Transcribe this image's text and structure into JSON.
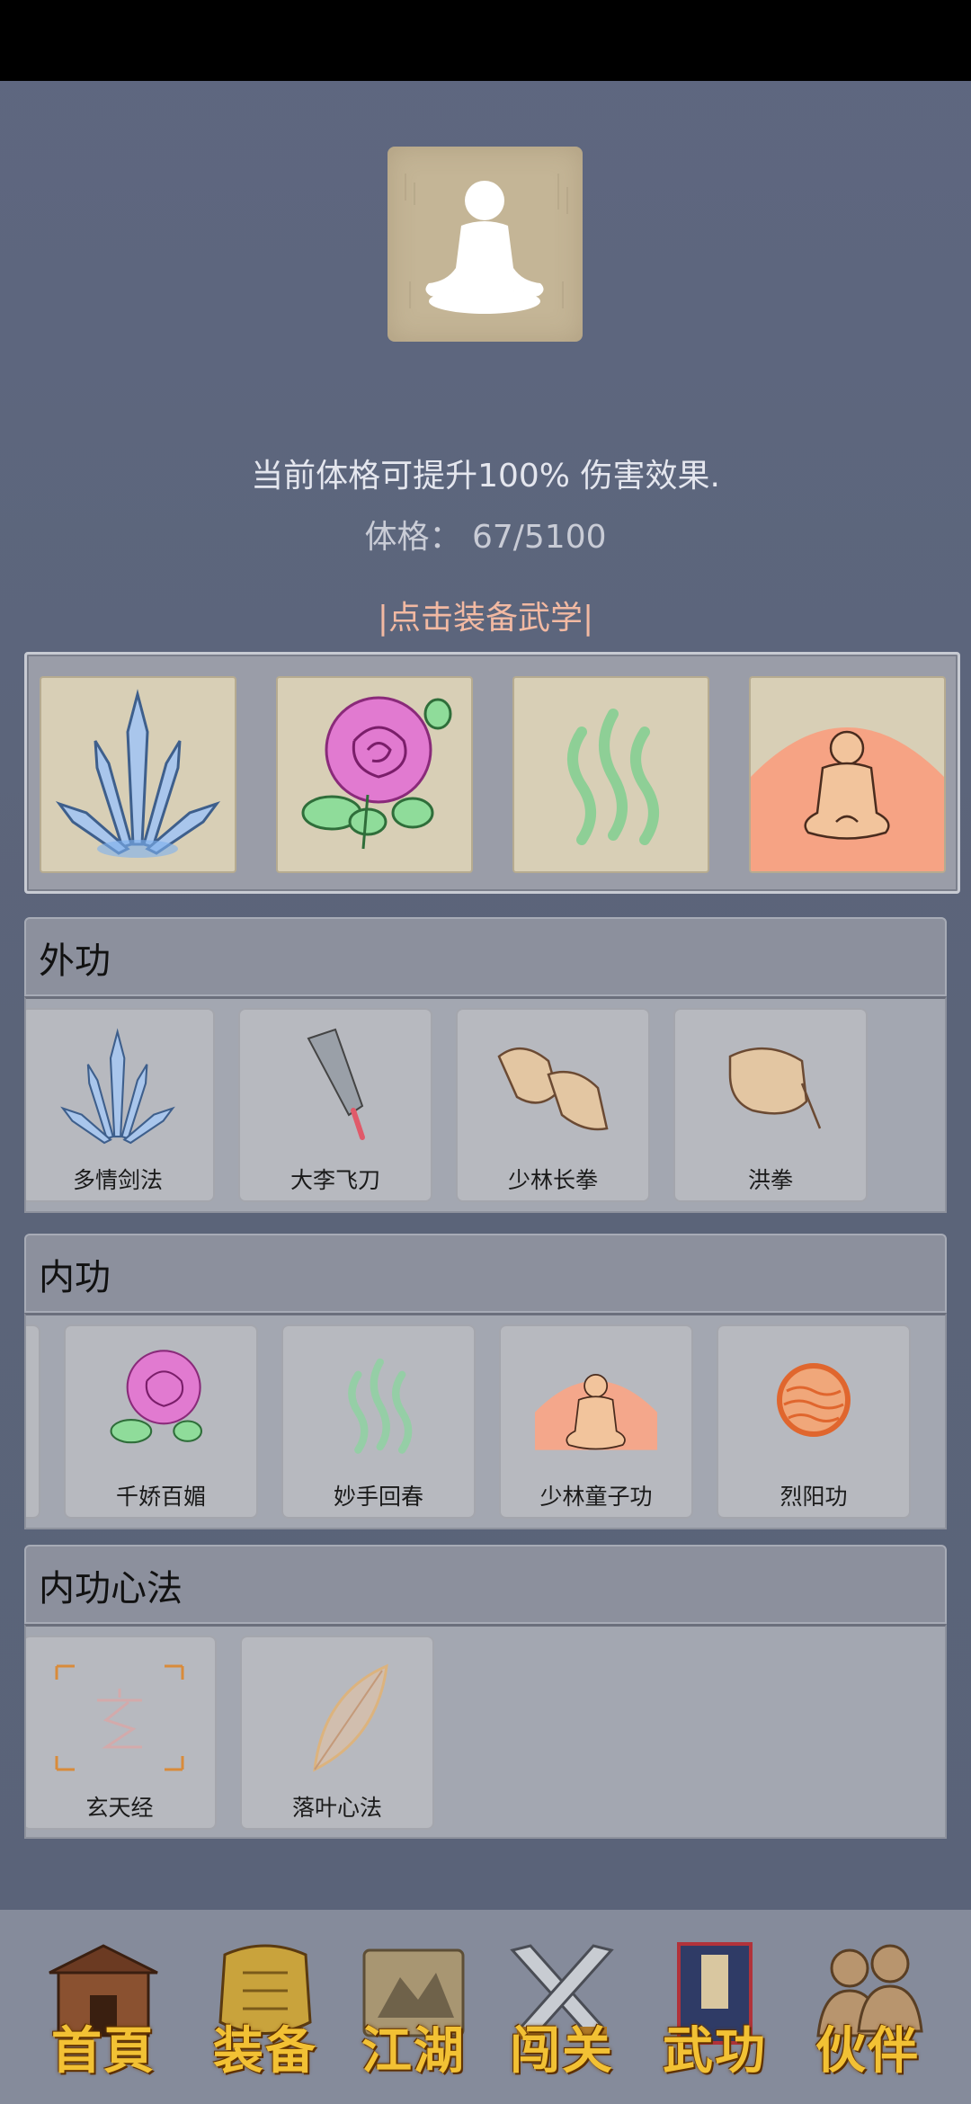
{
  "header": {
    "description": "当前体格可提升100% 伤害效果.",
    "stat_label": "体格：",
    "stat_value": "67/5100",
    "equip_prompt": "|点击装备武学|"
  },
  "colors": {
    "background": "#5b6479",
    "link": "#f2b9a2",
    "nav_text": "#f2c134"
  },
  "equipped_slots": [
    {
      "icon": "crystal-blades-icon"
    },
    {
      "icon": "rose-icon"
    },
    {
      "icon": "green-waves-icon"
    },
    {
      "icon": "meditating-monk-icon"
    }
  ],
  "sections": [
    {
      "title": "外功",
      "items": [
        {
          "label": "多情剑法",
          "icon": "crystal-blades-icon"
        },
        {
          "label": "大李飞刀",
          "icon": "flying-knife-icon"
        },
        {
          "label": "少林长拳",
          "icon": "fists-icon"
        },
        {
          "label": "洪拳",
          "icon": "fist-icon"
        }
      ]
    },
    {
      "title": "内功",
      "items": [
        {
          "label": "千娇百媚",
          "icon": "rose-icon"
        },
        {
          "label": "妙手回春",
          "icon": "green-waves-icon"
        },
        {
          "label": "少林童子功",
          "icon": "meditating-monk-icon"
        },
        {
          "label": "烈阳功",
          "icon": "sun-orb-icon"
        }
      ]
    },
    {
      "title": "内功心法",
      "items": [
        {
          "label": "玄天经",
          "icon": "xuan-scroll-icon"
        },
        {
          "label": "落叶心法",
          "icon": "leaf-icon"
        }
      ]
    }
  ],
  "bottom_nav": [
    {
      "label": "首頁",
      "icon": "house-icon"
    },
    {
      "label": "装备",
      "icon": "armor-icon"
    },
    {
      "label": "江湖",
      "icon": "map-scroll-icon"
    },
    {
      "label": "闯关",
      "icon": "crossed-swords-icon"
    },
    {
      "label": "武功",
      "icon": "book-icon"
    },
    {
      "label": "伙伴",
      "icon": "partners-icon"
    }
  ]
}
